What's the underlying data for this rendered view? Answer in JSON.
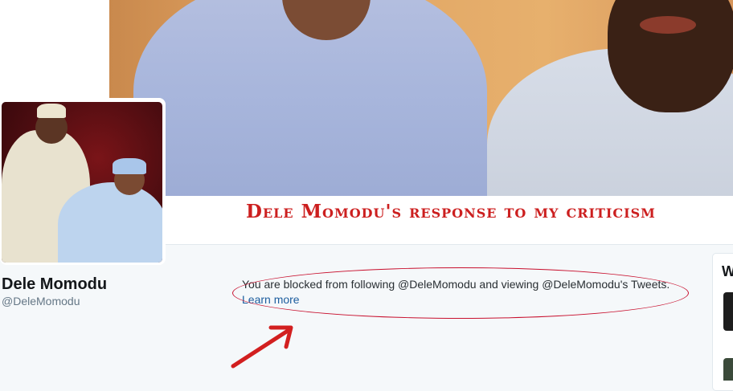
{
  "header": {
    "caption": "Dele Momodu's response to my criticism"
  },
  "profile": {
    "name": "Dele Momodu",
    "handle": "@DeleMomodu"
  },
  "blocked_notice": {
    "message": "You are blocked from following @DeleMomodu and viewing @DeleMomodu's Tweets.",
    "link_label": "Learn more"
  },
  "sidebar": {
    "heading_fragment": "W"
  },
  "colors": {
    "annotation_red": "#c8102e",
    "link_blue": "#1c5d9e",
    "caption_red": "#cc1f1f"
  }
}
